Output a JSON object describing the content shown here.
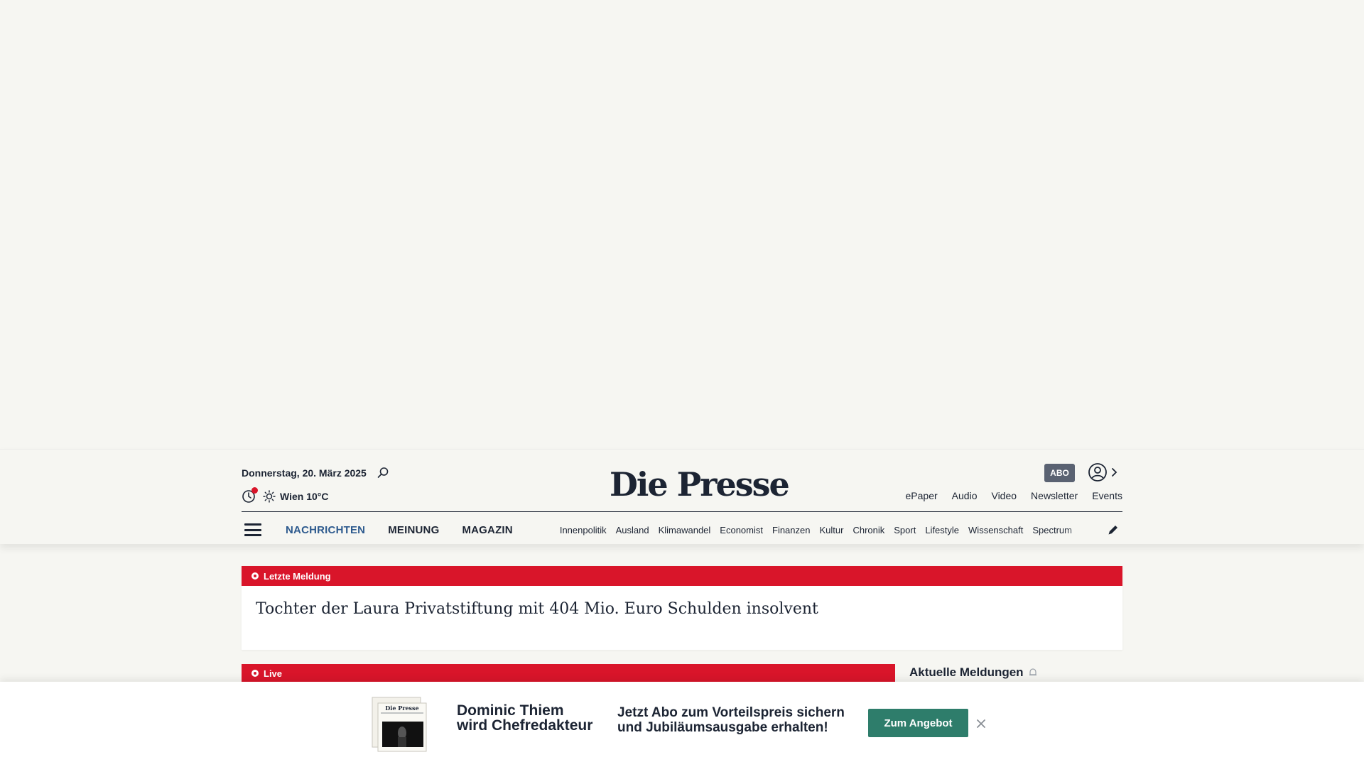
{
  "header": {
    "date": "Donnerstag, 20. März 2025",
    "weather": "Wien 10°C",
    "logo": "Die Presse",
    "abo_label": "ABO",
    "top_links": [
      "ePaper",
      "Audio",
      "Video",
      "Newsletter",
      "Events"
    ]
  },
  "nav": {
    "main": [
      "NACHRICHTEN",
      "MEINUNG",
      "MAGAZIN"
    ],
    "active": "NACHRICHTEN",
    "sub": [
      "Innenpolitik",
      "Ausland",
      "Klimawandel",
      "Economist",
      "Finanzen",
      "Kultur",
      "Chronik",
      "Sport",
      "Lifestyle",
      "Wissenschaft",
      "Spectrum"
    ]
  },
  "breaking": {
    "label": "Letzte Meldung",
    "headline": "Tochter der Laura Privatstiftung mit 404 Mio. Euro Schulden insolvent"
  },
  "live": {
    "label": "Live"
  },
  "sidebar": {
    "aktuelle_label": "Aktuelle Meldungen"
  },
  "promo": {
    "title_line1": "Dominic Thiem",
    "title_line2": "wird Chefredakteur",
    "text_line1": "Jetzt Abo zum Vorteilspreis sichern",
    "text_line2": "und Jubiläumsausgabe erhalten!",
    "button_label": "Zum Angebot",
    "image_logo_text": "Die Presse"
  },
  "colors": {
    "accent_red": "#d9152a",
    "nav_active": "#2d5a8e",
    "button_green": "#2e7d6b",
    "text_dark": "#1c2433",
    "background": "#f6f6f2"
  }
}
